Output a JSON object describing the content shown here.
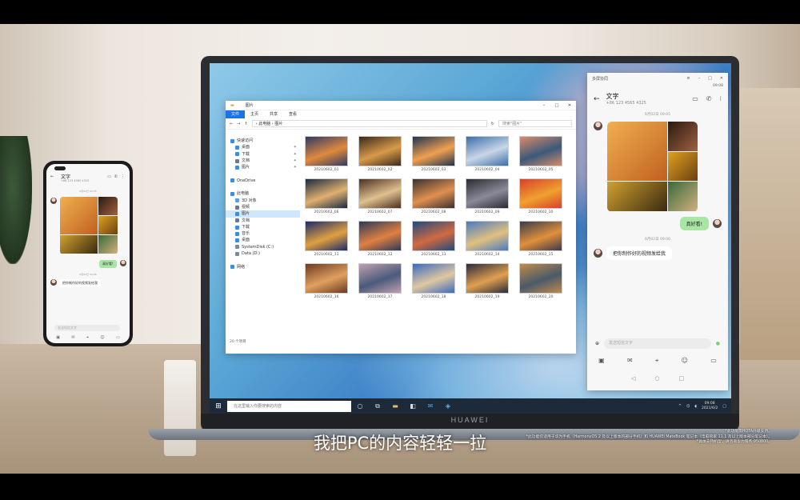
{
  "explorer": {
    "title": "图片",
    "ribbon_tabs": [
      "文件",
      "主页",
      "共享",
      "查看"
    ],
    "path": "› 此电脑 › 图片",
    "search_placeholder": "搜索\"图片\"",
    "nav_items": [
      {
        "label": "快速访问",
        "selected": false,
        "pinned": false,
        "color": "#3b8de0"
      },
      {
        "label": "桌面",
        "selected": false,
        "pinned": true,
        "color": "#3b8de0"
      },
      {
        "label": "下载",
        "selected": false,
        "pinned": true,
        "color": "#3b8de0"
      },
      {
        "label": "文档",
        "selected": false,
        "pinned": true,
        "color": "#6a7a8a"
      },
      {
        "label": "图片",
        "selected": false,
        "pinned": true,
        "color": "#3b8de0"
      },
      {
        "label": "",
        "selected": false,
        "pinned": false,
        "color": "#fff"
      },
      {
        "label": "OneDrive",
        "selected": false,
        "pinned": false,
        "color": "#3b8de0"
      },
      {
        "label": "",
        "selected": false,
        "pinned": false,
        "color": "#fff"
      },
      {
        "label": "此电脑",
        "selected": false,
        "pinned": false,
        "color": "#3b8de0"
      },
      {
        "label": "3D 对象",
        "selected": false,
        "pinned": false,
        "color": "#5aa0e0"
      },
      {
        "label": "视频",
        "selected": false,
        "pinned": false,
        "color": "#6a7a8a"
      },
      {
        "label": "图片",
        "selected": true,
        "pinned": false,
        "color": "#3b8de0"
      },
      {
        "label": "文档",
        "selected": false,
        "pinned": false,
        "color": "#6a7a8a"
      },
      {
        "label": "下载",
        "selected": false,
        "pinned": false,
        "color": "#3b8de0"
      },
      {
        "label": "音乐",
        "selected": false,
        "pinned": false,
        "color": "#3b8de0"
      },
      {
        "label": "桌面",
        "selected": false,
        "pinned": false,
        "color": "#3b8de0"
      },
      {
        "label": "SystemDisk (C:)",
        "selected": false,
        "pinned": false,
        "color": "#7a8a9a"
      },
      {
        "label": "Data (D:)",
        "selected": false,
        "pinned": false,
        "color": "#7a8a9a"
      },
      {
        "label": "",
        "selected": false,
        "pinned": false,
        "color": "#fff"
      },
      {
        "label": "网络",
        "selected": false,
        "pinned": false,
        "color": "#3b8de0"
      }
    ],
    "files": [
      {
        "name": "20210602_01",
        "c1": "#2d3a63",
        "c2": "#e08a3c"
      },
      {
        "name": "20210602_02",
        "c1": "#3a2a1c",
        "c2": "#d89a4a"
      },
      {
        "name": "20210602_03",
        "c1": "#1f3550",
        "c2": "#f0a050"
      },
      {
        "name": "20210602_04",
        "c1": "#3a6ea8",
        "c2": "#c9d6e8"
      },
      {
        "name": "20210602_05",
        "c1": "#d98a6a",
        "c2": "#3a5a7a"
      },
      {
        "name": "20210602_06",
        "c1": "#1a2a40",
        "c2": "#e0b070"
      },
      {
        "name": "20210602_07",
        "c1": "#4a3020",
        "c2": "#e0c090"
      },
      {
        "name": "20210602_08",
        "c1": "#3a3030",
        "c2": "#e09050"
      },
      {
        "name": "20210602_09",
        "c1": "#2a2a30",
        "c2": "#8a8a9a"
      },
      {
        "name": "20210602_10",
        "c1": "#d8402a",
        "c2": "#f0a030"
      },
      {
        "name": "20210602_11",
        "c1": "#1a2a6a",
        "c2": "#e0a040"
      },
      {
        "name": "20210602_12",
        "c1": "#2a3a5a",
        "c2": "#e08040"
      },
      {
        "name": "20210602_13",
        "c1": "#1e4a80",
        "c2": "#d06a40"
      },
      {
        "name": "20210602_14",
        "c1": "#4a7ac0",
        "c2": "#e0c080"
      },
      {
        "name": "20210602_15",
        "c1": "#3a3a4a",
        "c2": "#e0903a"
      },
      {
        "name": "20210602_16",
        "c1": "#6a3a20",
        "c2": "#e0a060"
      },
      {
        "name": "20210602_17",
        "c1": "#c0a0b0",
        "c2": "#4a5a7a"
      },
      {
        "name": "20210602_18",
        "c1": "#3a6ac0",
        "c2": "#e0c8a0"
      },
      {
        "name": "20210602_19",
        "c1": "#2a2a3a",
        "c2": "#e0a050"
      },
      {
        "name": "20210602_20",
        "c1": "#c08a4a",
        "c2": "#4a5a6a"
      }
    ],
    "status": "20 个项目"
  },
  "mirror": {
    "title": "多屏协同",
    "status_time": "09:08",
    "contact_name": "文字",
    "contact_number": "+86 123 4565 4325",
    "time1": "6月02日 09:05",
    "sent_text": "真好看!",
    "time2": "6月02日 09:06",
    "received_text": "把你制作好的视频发给我",
    "input_placeholder": "发送短信文字"
  },
  "taskbar": {
    "search_placeholder": "在这里输入你要搜索的内容",
    "time": "09:08",
    "date": "2021/6/2"
  },
  "laptop_brand": "HUAWEI",
  "phone": {
    "contact_name": "文字",
    "contact_number": "+86 123 4565 4325",
    "time1": "6月02日 09:05",
    "sent_text": "真好看!",
    "time2": "6月02日 09:06",
    "received_text": "把你制作好的视频发给我",
    "input_placeholder": "发送短信文字"
  },
  "subtitle": "我把PC的内容轻轻一拉",
  "disclaimer": [
    "*此功能需HOTA升级支持。",
    "*此功能仅适用于华为手机（HarmonyOS 2 及以上版本的部分手机）和 HUAWEI MateBook 笔记本（电脑管家 11.1 及以上版本部分笔记本）。",
    "*具体支持机型，请咨询华为服务 950800。"
  ],
  "colors": {
    "accent": "#1a73e8",
    "bubble_green": "#a8e6a3",
    "taskbar": "#1d2a3a"
  }
}
